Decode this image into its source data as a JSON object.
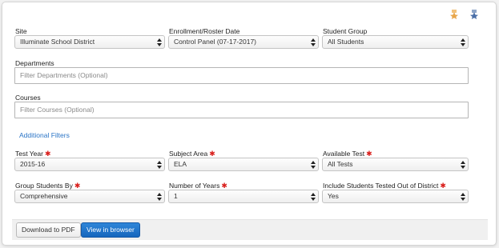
{
  "header": {
    "icons": [
      {
        "name": "favorite-star-icon",
        "color": "#e8a64a"
      },
      {
        "name": "pinned-report-icon",
        "color": "#4a6fa8"
      }
    ]
  },
  "filters": {
    "site": {
      "label": "Site",
      "value": "Illuminate School District"
    },
    "enrollment_date": {
      "label": "Enrollment/Roster Date",
      "value": "Control Panel (07-17-2017)"
    },
    "student_group": {
      "label": "Student Group",
      "value": "All Students"
    },
    "departments": {
      "label": "Departments",
      "placeholder": "Filter Departments (Optional)"
    },
    "courses": {
      "label": "Courses",
      "placeholder": "Filter Courses (Optional)"
    },
    "additional_filters_link": "Additional Filters",
    "test_year": {
      "label": "Test Year",
      "value": "2015-16",
      "required": "✱"
    },
    "subject_area": {
      "label": "Subject Area",
      "value": "ELA",
      "required": "✱"
    },
    "available_test": {
      "label": "Available Test",
      "value": "All Tests",
      "required": "✱"
    },
    "group_by": {
      "label": "Group Students By",
      "value": "Comprehensive",
      "required": "✱"
    },
    "num_years": {
      "label": "Number of Years",
      "value": "1",
      "required": "✱"
    },
    "include_out_of_district": {
      "label": "Include Students Tested Out of District",
      "value": "Yes",
      "required": "✱"
    }
  },
  "footer": {
    "download_pdf_label": "Download to PDF",
    "view_browser_label": "View in browser"
  },
  "colors": {
    "link": "#2a74c6",
    "required": "#d9201d",
    "primary_button": "#1f72c8"
  }
}
